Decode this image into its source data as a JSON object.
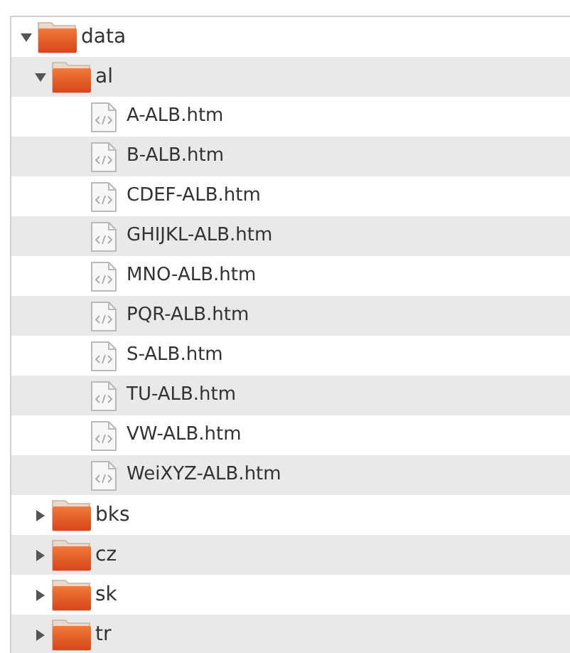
{
  "tree": [
    {
      "kind": "folder",
      "name": "data",
      "expanded": true,
      "children": [
        {
          "kind": "folder",
          "name": "al",
          "expanded": true,
          "children": [
            {
              "kind": "file",
              "name": "A-ALB.htm"
            },
            {
              "kind": "file",
              "name": "B-ALB.htm"
            },
            {
              "kind": "file",
              "name": "CDEF-ALB.htm"
            },
            {
              "kind": "file",
              "name": "GHIJKL-ALB.htm"
            },
            {
              "kind": "file",
              "name": "MNO-ALB.htm"
            },
            {
              "kind": "file",
              "name": "PQR-ALB.htm"
            },
            {
              "kind": "file",
              "name": "S-ALB.htm"
            },
            {
              "kind": "file",
              "name": "TU-ALB.htm"
            },
            {
              "kind": "file",
              "name": "VW-ALB.htm"
            },
            {
              "kind": "file",
              "name": "WeiXYZ-ALB.htm"
            }
          ]
        },
        {
          "kind": "folder",
          "name": "bks",
          "expanded": false
        },
        {
          "kind": "folder",
          "name": "cz",
          "expanded": false
        },
        {
          "kind": "folder",
          "name": "sk",
          "expanded": false
        },
        {
          "kind": "folder",
          "name": "tr",
          "expanded": false
        }
      ]
    }
  ]
}
